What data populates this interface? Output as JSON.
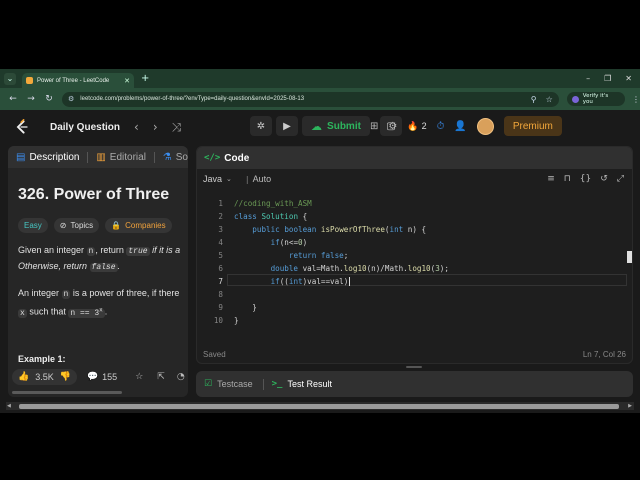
{
  "browser": {
    "tab_title": "Power of Three - LeetCode",
    "url": "leetcode.com/problems/power-of-three/?envType=daily-question&envId=2025-08-13",
    "profile_label": "Verify it's you"
  },
  "header": {
    "daily_question": "Daily Question",
    "submit_label": "Submit",
    "streak_count": "2",
    "premium_label": "Premium"
  },
  "left_panel": {
    "tabs": [
      {
        "label": "Description",
        "icon": "description-icon"
      },
      {
        "label": "Editorial",
        "icon": "editorial-icon"
      },
      {
        "label": "So",
        "icon": "solutions-icon"
      }
    ],
    "title": "326. Power of Three",
    "tags": {
      "difficulty": "Easy",
      "topics": "Topics",
      "companies": "Companies"
    },
    "desc1": {
      "pre": "Given an integer ",
      "n": "n",
      "mid": ", return ",
      "true": "true",
      "rest": " if it is a"
    },
    "desc2": {
      "pre": "Otherwise, return ",
      "false": "false",
      "end": "."
    },
    "desc3": {
      "pre": "An integer ",
      "n": "n",
      "rest": " is a power of three, if there"
    },
    "desc4": {
      "x": "x",
      "mid": " such that ",
      "expr": "n == 3",
      "sup": "x",
      "end": "."
    },
    "example_heading": "Example 1:",
    "likes": "3.5K",
    "comments": "155"
  },
  "code_panel": {
    "title": "Code",
    "language": "Java",
    "mode": "Auto",
    "lines": [
      "1",
      "2",
      "3",
      "4",
      "5",
      "6",
      "7",
      "8",
      "9",
      "10"
    ],
    "code": {
      "l1": "//coding_with_ASM",
      "l2a": "class",
      "l2b": "Solution",
      "l2c": " {",
      "l3a": "public",
      "l3b": "boolean",
      "l3c": "isPowerOfThree",
      "l3d": "(",
      "l3e": "int",
      "l3f": " n) {",
      "l4a": "if",
      "l4b": "(n<=",
      "l4c": "0",
      "l4d": ")",
      "l5a": "return",
      "l5b": "false",
      "l5c": ";",
      "l6a": "double",
      "l6b": " val=Math.",
      "l6c": "log10",
      "l6d": "(n)/Math.",
      "l6e": "log10",
      "l6f": "(",
      "l6g": "3",
      "l6h": ");",
      "l7a": "if",
      "l7b": "((",
      "l7c": "int",
      "l7d": ")val==val)",
      "l9": "}",
      "l10": "}"
    },
    "status": "Saved",
    "cursor": "Ln 7, Col 26"
  },
  "bottom_panel": {
    "testcase": "Testcase",
    "test_result": "Test Result"
  },
  "colors": {
    "accent_green": "#2db55d",
    "premium": "#f2a73b",
    "easy": "#46c6c2"
  }
}
